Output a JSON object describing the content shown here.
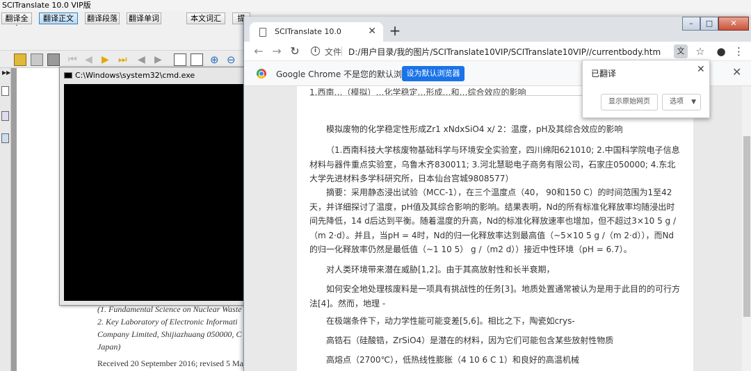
{
  "app": {
    "title": "SCITranslate 10.0 VIP版",
    "toolbar": [
      "翻译全文",
      "翻译正文",
      "翻译段落",
      "翻译单词",
      "本文词汇",
      "提取…"
    ],
    "pdf_lines": [
      "(1. Fundamental Science on Nuclear Waste",
      "2. Key Laboratory of Electronic Informati",
      "Company Limited, Shijiazhuang 050000, C",
      "Japan)",
      "Received 20 September 2016; revised 5 Ma"
    ]
  },
  "cmd": {
    "title": "C:\\Windows\\system32\\cmd.exe"
  },
  "chrome": {
    "tab_title": "SCITranslate 10.0",
    "tab_close": "✕",
    "new_tab": "+",
    "window_buttons": [
      "–",
      "□",
      "✕"
    ],
    "nav": {
      "back": "←",
      "forward": "→",
      "reload": "↻"
    },
    "scheme": "文件",
    "url": "D:/用户目录/我的图片/SCITranslate10VIP/SCITranslate10VIP//currentbody.htm",
    "infobar": {
      "text": "Google Chrome 不是您的默认浏览器",
      "button": "设为默认浏览器",
      "close": "✕"
    },
    "translate_popup": {
      "title": "已翻译",
      "show_original": "显示原始网页",
      "options": "选项",
      "close": "✕"
    }
  },
  "document": {
    "top_fragment": "1.西南…（模拟）…化学稳定…形成…和…综合效应的影响",
    "paragraphs": [
      "模拟废物的化学稳定性形成Zr1 xNdxSiO4 x/ 2：温度，pH及其综合效应的影响",
      "（1.西南科技大学核废物基础科学与环境安全实验室，四川绵阳621010; 2.中国科学院电子信息材料与器件重点实验室，乌鲁木齐830011; 3.河北慧聪电子商务有限公司，石家庄050000; 4.东北大学先进材料多学科研究所，日本仙台宫城9808577）",
      "摘要：采用静态浸出试验（MCC-1），在三个温度点（40， 90和150 C）的时间范围为1至42天，并详细探讨了温度，pH值及其综合影响的影响。结果表明，Nd的所有标准化释放率均随浸出时间先降低，14 d后达到平衡。随着温度的升高，Nd的标准化释放速率也增加，但不超过3×10 5 g /（m 2·d）。并且，当pH = 4时，Nd的归一化释放率达到最高值（~5×10 5 g /（m 2·d）），而Nd的归一化释放率仍然是最低值（~1 10 5） g /（m2 d））接近中性环境（pH = 6.7）。",
      "对人类环境带来潜在威胁[1,2]。由于其高放射性和长半衰期，",
      "如何安全地处理核废料是一项具有挑战性的任务[3]。地质处置通常被认为是用于此目的的可行方法[4]。然而，地理 -",
      "在极端条件下，动力学性能可能变差[5,6]。相比之下，陶瓷如crys-",
      "高锆石（硅酸锆，ZrSiO4）是潜在的材料，因为它们可能包含某些放射性物质",
      "高熔点（2700℃），低热线性膨胀（4 10 6 C 1）和良好的高温机械"
    ]
  }
}
